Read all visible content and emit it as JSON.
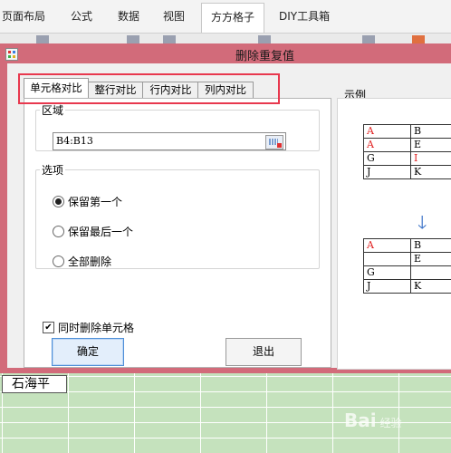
{
  "ribbon": {
    "tabs": [
      "页面布局",
      "公式",
      "数据",
      "视图",
      "方方格子",
      "DIY工具箱"
    ],
    "active_tab": "方方格子"
  },
  "dialog": {
    "title": "删除重复值",
    "tabs": [
      "单元格对比",
      "整行对比",
      "行内对比",
      "列内对比"
    ],
    "selected_tab": "单元格对比",
    "range_group_label": "区域",
    "range_value": "B4:B13",
    "options_group_label": "选项",
    "options": [
      {
        "label": "保留第一个",
        "selected": true
      },
      {
        "label": "保留最后一个",
        "selected": false
      },
      {
        "label": "全部删除",
        "selected": false
      }
    ],
    "delete_cells_label": "同时删除单元格",
    "delete_cells_checked": true,
    "ok_label": "确定",
    "exit_label": "退出",
    "sample_label": "示例",
    "sample_before": [
      [
        "A",
        "B"
      ],
      [
        "A",
        "E"
      ],
      [
        "G",
        "I"
      ],
      [
        "J",
        "K"
      ]
    ],
    "sample_after": [
      [
        "A",
        "B"
      ],
      [
        "",
        "E"
      ],
      [
        "G",
        ""
      ],
      [
        "J",
        "K"
      ]
    ],
    "checkmark": "✔",
    "arrow_glyph": "🡓"
  },
  "sheet": {
    "name_cell": "石海平"
  },
  "watermark": {
    "text": "Bai",
    "sub": "经验"
  },
  "colors": {
    "dialog_frame": "#d26b7a",
    "highlight": "#e8384e",
    "sheet_bg": "#c3deb8"
  }
}
